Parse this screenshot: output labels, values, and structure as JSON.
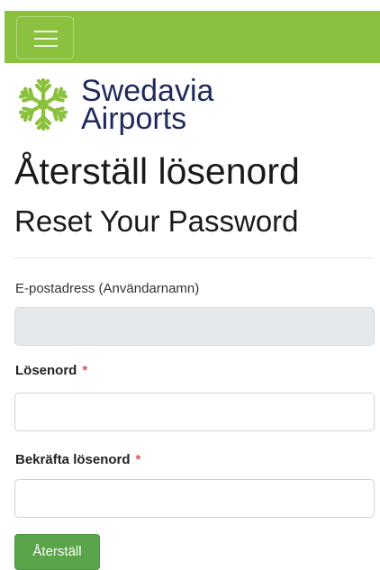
{
  "header": {
    "menu_icon": "hamburger-menu-icon",
    "bar_color": "#8cc13f"
  },
  "logo": {
    "icon": "snowflake-icon",
    "line1": "Swedavia",
    "line2": "Airports",
    "text_color": "#1f2a5c"
  },
  "page": {
    "title_sv": "Återställ lösenord",
    "title_en": "Reset Your Password"
  },
  "form": {
    "email": {
      "label": "E-postadress (Användarnamn)",
      "value": ""
    },
    "password": {
      "label": "Lösenord",
      "required_mark": "*",
      "value": ""
    },
    "confirm": {
      "label": "Bekräfta lösenord",
      "required_mark": "*",
      "value": ""
    },
    "submit_label": "Återställ",
    "button_color": "#5aa44a"
  }
}
